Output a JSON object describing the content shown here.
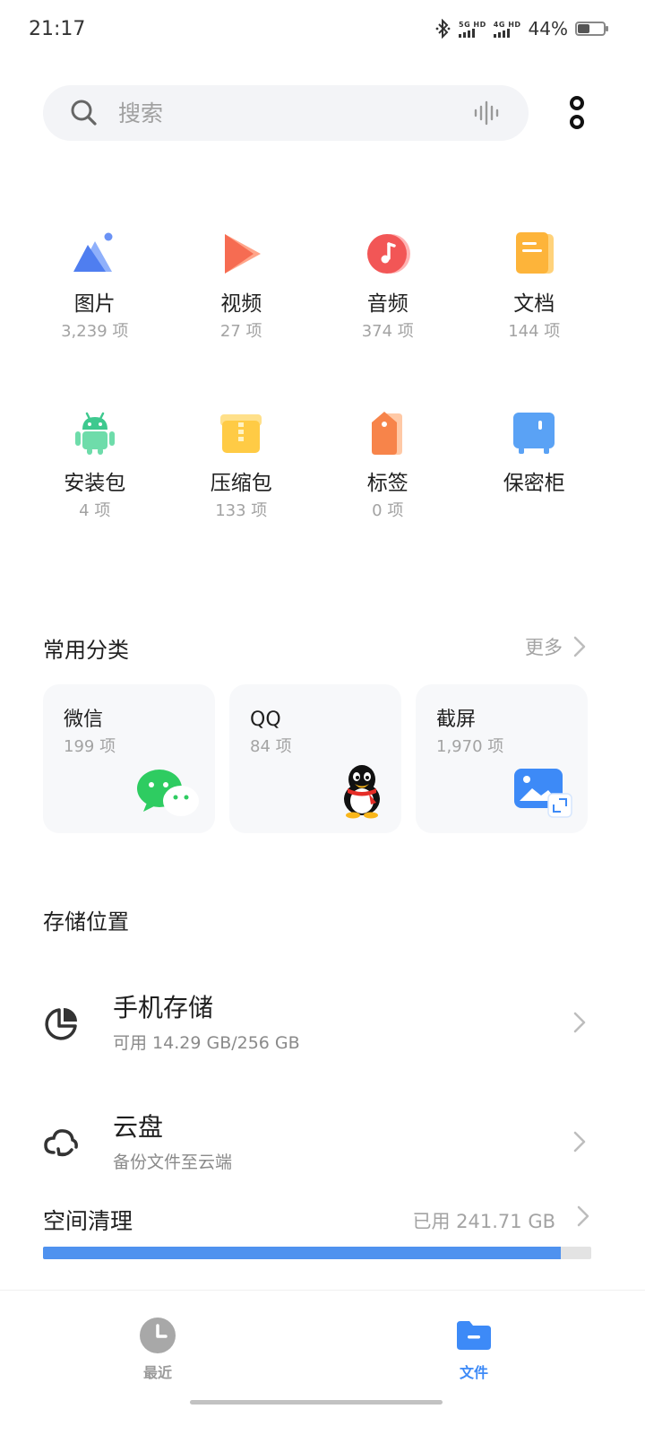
{
  "status": {
    "time": "21:17",
    "net1": "5G HD",
    "net2": "4G HD",
    "battery": "44%",
    "battery_level": 0.44
  },
  "search": {
    "placeholder": "搜索"
  },
  "categories": [
    {
      "name": "图片",
      "count": "3,239 项",
      "icon": "image-icon"
    },
    {
      "name": "视频",
      "count": "27 项",
      "icon": "video-icon"
    },
    {
      "name": "音频",
      "count": "374 项",
      "icon": "audio-icon"
    },
    {
      "name": "文档",
      "count": "144 项",
      "icon": "document-icon"
    },
    {
      "name": "安装包",
      "count": "4 项",
      "icon": "android-icon"
    },
    {
      "name": "压缩包",
      "count": "133 项",
      "icon": "archive-icon"
    },
    {
      "name": "标签",
      "count": "0 项",
      "icon": "tag-icon"
    },
    {
      "name": "保密柜",
      "count": "",
      "icon": "safe-icon"
    }
  ],
  "common": {
    "title": "常用分类",
    "more": "更多",
    "cards": [
      {
        "name": "微信",
        "count": "199 项",
        "icon": "wechat-icon"
      },
      {
        "name": "QQ",
        "count": "84 项",
        "icon": "qq-icon"
      },
      {
        "name": "截屏",
        "count": "1,970 项",
        "icon": "screenshot-icon"
      }
    ]
  },
  "storage": {
    "title": "存储位置",
    "phone": {
      "name": "手机存储",
      "sub": "可用 14.29 GB/256 GB"
    },
    "cloud": {
      "name": "云盘",
      "sub": "备份文件至云端"
    }
  },
  "clean": {
    "title": "空间清理",
    "used": "已用 241.71 GB",
    "used_fraction": 0.944
  },
  "nav": {
    "recent": {
      "label": "最近",
      "color": "#9a9a9a"
    },
    "files": {
      "label": "文件",
      "color": "#3d8af7"
    }
  },
  "colors": {
    "accent": "#3d8af7",
    "progress": "#4f92ef"
  }
}
